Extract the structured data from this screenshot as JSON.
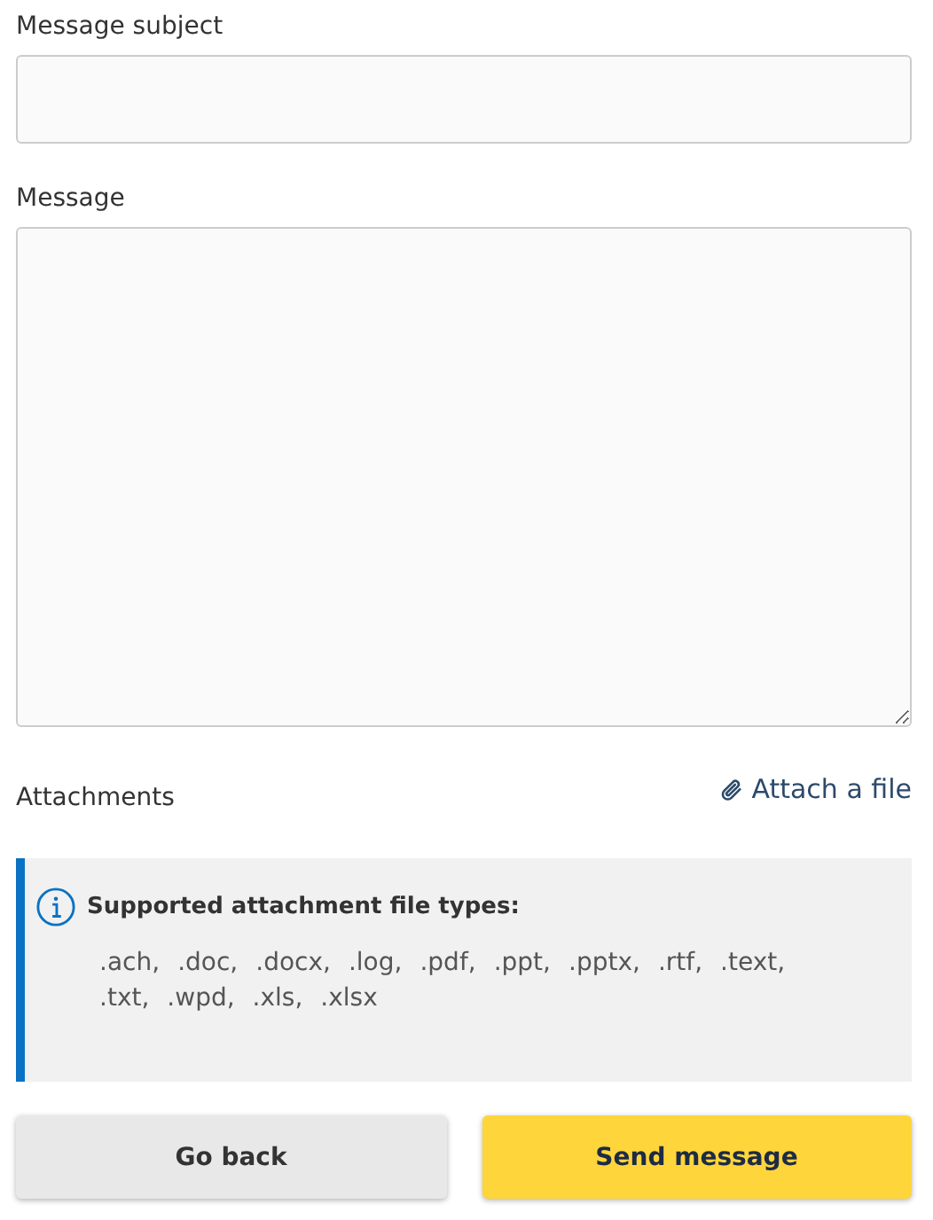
{
  "subject": {
    "label": "Message subject"
  },
  "message": {
    "label": "Message"
  },
  "attachments": {
    "label": "Attachments",
    "link": "Attach a file"
  },
  "info": {
    "title": "Supported attachment file types:",
    "types": [
      ".ach,",
      ".doc,",
      ".docx,",
      ".log,",
      ".pdf,",
      ".ppt,",
      ".pptx,",
      ".rtf,",
      ".text,",
      ".txt,",
      ".wpd,",
      ".xls,",
      ".xlsx"
    ]
  },
  "buttons": [
    {
      "label": "Go back",
      "kind": "secondary"
    },
    {
      "label": "Send message",
      "kind": "primary"
    }
  ]
}
